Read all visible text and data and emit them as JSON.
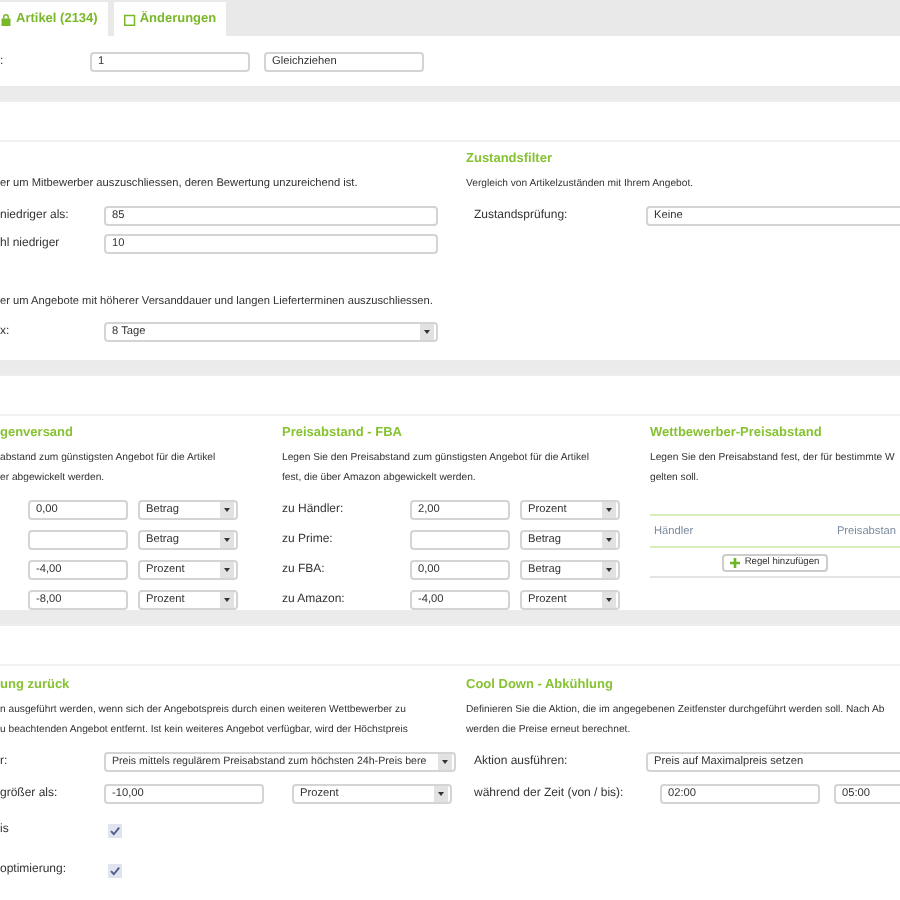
{
  "tabs": [
    {
      "label": "Artikel (2134)"
    },
    {
      "label": "Änderungen"
    }
  ],
  "strategy_row": {
    "label": ":",
    "fields": [
      {
        "kind": "input",
        "value": "1"
      },
      {
        "kind": "input",
        "value": "Gleichziehen"
      }
    ]
  },
  "rating_filter": {
    "description": "er um Mitbewerber auszuschliessen, deren Bewertung unzureichend ist.",
    "fields": [
      {
        "label": "niedriger als:",
        "value": "85"
      },
      {
        "label": "hl niedriger",
        "value": "10"
      }
    ]
  },
  "condition_filter": {
    "title": "Zustandsfilter",
    "description": "Vergleich von Artikelzuständen mit Ihrem Angebot.",
    "label": "Zustandsprüfung:",
    "value": "Keine"
  },
  "shipping_filter": {
    "description": "er um Angebote mit höherer Versanddauer und langen Lieferterminen auszuschliessen.",
    "label": "x:",
    "value": "8 Tage"
  },
  "merchant_shipping": {
    "title": "genversand",
    "description": "abstand zum günstigsten Angebot für die Artikel\ner abgewickelt werden.",
    "rows": [
      {
        "value": "0,00",
        "unit": "Betrag"
      },
      {
        "unit": "Betrag"
      },
      {
        "value": "-4,00",
        "unit": "Prozent"
      },
      {
        "value": "-8,00",
        "unit": "Prozent"
      }
    ]
  },
  "fba": {
    "title": "Preisabstand - FBA",
    "description": "Legen Sie den Preisabstand zum günstigsten Angebot für die Artikel\nfest, die über Amazon abgewickelt werden.",
    "rows": [
      {
        "label": "zu Händler:",
        "value": "2,00",
        "unit": "Prozent"
      },
      {
        "label": "zu Prime:",
        "unit": "Betrag"
      },
      {
        "label": "zu FBA:",
        "value": "0,00",
        "unit": "Betrag"
      },
      {
        "label": "zu Amazon:",
        "value": "-4,00",
        "unit": "Prozent"
      }
    ]
  },
  "competitor_gap": {
    "title": "Wettbewerber-Preisabstand",
    "description": "Legen Sie den Preisabstand fest, der für bestimmte W\ngelten soll.",
    "columns": [
      "Händler",
      "Preisabstan"
    ],
    "add_button": "Regel hinzufügen"
  },
  "fallback": {
    "title": "ung zurück",
    "description": "n ausgeführt werden, wenn sich der Angebotspreis durch einen weiteren Wettbewerber zu\nu beachtenden Angebot entfernt. Ist kein weiteres Angebot verfügbar, wird der Höchstpreis",
    "rows": [
      {
        "kind": "select",
        "label": "r:",
        "value": "Preis mittels regulärem Preisabstand zum höchsten 24h-Preis bere"
      },
      {
        "kind": "input-select",
        "label": "größer als:",
        "value": "-10,00",
        "unit": "Prozent"
      },
      {
        "kind": "checkbox",
        "label": "is",
        "checked": true
      },
      {
        "kind": "checkbox",
        "label": "optimierung:",
        "checked": true
      }
    ]
  },
  "cool_down": {
    "title": "Cool Down - Abkühlung",
    "description": "Definieren Sie die Aktion, die im angegebenen Zeitfenster durchgeführt werden soll. Nach Ab\nwerden die Preise erneut berechnet.",
    "action_label": "Aktion ausführen:",
    "action_value": "Preis auf Maximalpreis setzen",
    "time_label": "während der Zeit (von / bis):",
    "time_from": "02:00",
    "time_to": "05:00"
  }
}
